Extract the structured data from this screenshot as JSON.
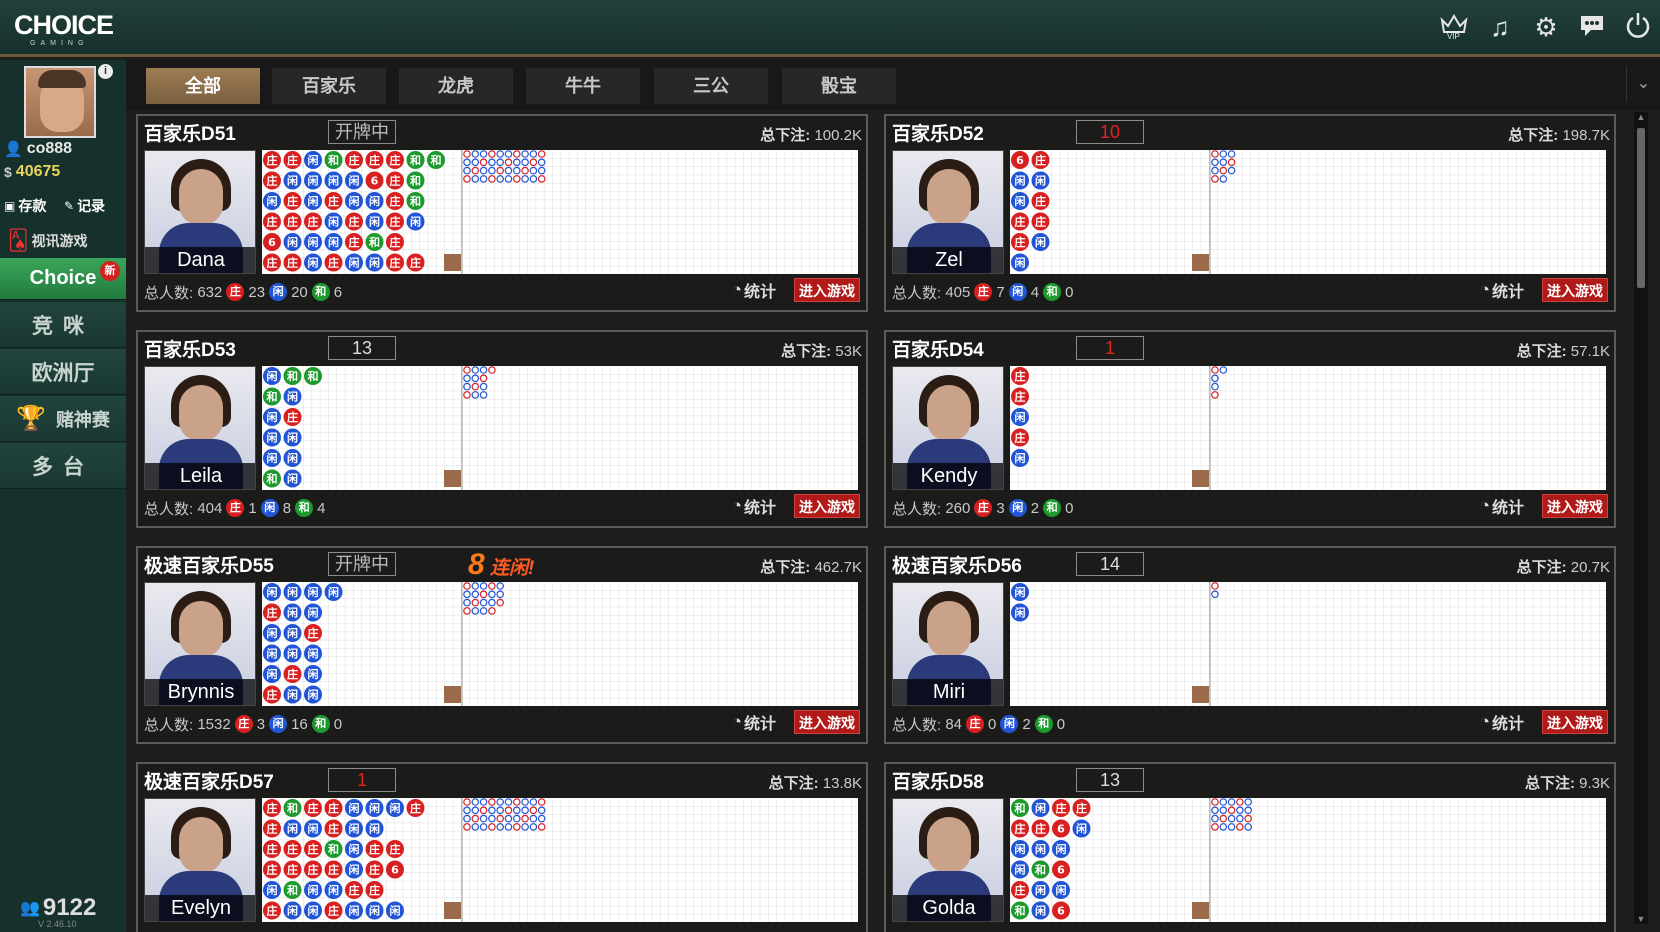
{
  "brand": {
    "logo": "CHOICE",
    "sub": "GAMING"
  },
  "user": {
    "name": "co888",
    "balance": "40675",
    "deposit": "存款",
    "records": "记录",
    "video": "视讯游戏"
  },
  "nav": [
    {
      "label": "Choice",
      "badge": "新"
    },
    {
      "label": "竞咪"
    },
    {
      "label": "欧洲厅"
    },
    {
      "label": "赌神赛"
    },
    {
      "label": "多台"
    }
  ],
  "online_count": "9122",
  "version": "V 2.46.10",
  "tabs": [
    "全部",
    "百家乐",
    "龙虎",
    "牛牛",
    "三公",
    "骰宝"
  ],
  "labels": {
    "total_bet": "总下注:",
    "players": "总人数:",
    "stats": "统计",
    "enter": "进入游戏",
    "banker": "庄",
    "player": "闲",
    "tie": "和"
  },
  "colors": {
    "banker": "#d82020",
    "player": "#2155d6",
    "tie": "#1d9a2d",
    "accent": "#8b6e49"
  },
  "tables": [
    {
      "name": "百家乐D51",
      "status": "开牌中",
      "status_type": "text",
      "streak": "",
      "total_bet": "100.2K",
      "dealer": "Dana",
      "players": "632",
      "banker": "23",
      "player": "20",
      "tie": "6"
    },
    {
      "name": "百家乐D52",
      "status": "10",
      "status_type": "red",
      "streak": "",
      "total_bet": "198.7K",
      "dealer": "Zel",
      "players": "405",
      "banker": "7",
      "player": "4",
      "tie": "0"
    },
    {
      "name": "百家乐D53",
      "status": "13",
      "status_type": "white",
      "streak": "",
      "total_bet": "53K",
      "dealer": "Leila",
      "players": "404",
      "banker": "1",
      "player": "8",
      "tie": "4"
    },
    {
      "name": "百家乐D54",
      "status": "1",
      "status_type": "red",
      "streak": "",
      "total_bet": "57.1K",
      "dealer": "Kendy",
      "players": "260",
      "banker": "3",
      "player": "2",
      "tie": "0"
    },
    {
      "name": "极速百家乐D55",
      "status": "开牌中",
      "status_type": "text",
      "streak_num": "8",
      "streak": "连闲!",
      "total_bet": "462.7K",
      "dealer": "Brynnis",
      "players": "1532",
      "banker": "3",
      "player": "16",
      "tie": "0"
    },
    {
      "name": "极速百家乐D56",
      "status": "14",
      "status_type": "white",
      "streak": "",
      "total_bet": "20.7K",
      "dealer": "Miri",
      "players": "84",
      "banker": "0",
      "player": "2",
      "tie": "0"
    },
    {
      "name": "极速百家乐D57",
      "status": "1",
      "status_type": "red",
      "streak": "",
      "total_bet": "13.8K",
      "dealer": "Evelyn",
      "players": "",
      "banker": "",
      "player": "",
      "tie": ""
    },
    {
      "name": "百家乐D58",
      "status": "13",
      "status_type": "white",
      "streak": "",
      "total_bet": "9.3K",
      "dealer": "Golda",
      "players": "",
      "banker": "",
      "player": "",
      "tie": ""
    }
  ],
  "bead_roads": [
    [
      "BBPTBBBTT",
      "BPPPP6BT",
      "PBPBPPBT",
      "BBBPBPBP",
      "6PPPBTB",
      "BBPBPPBB"
    ],
    [
      "6B",
      "PP",
      "PB",
      "BB",
      "BP",
      "P"
    ],
    [
      "PTT",
      "TP",
      "PB",
      "PP",
      "PP",
      "TP"
    ],
    [
      "B",
      "B",
      "P",
      "B",
      "P"
    ],
    [
      "PPPP",
      "BPP",
      "PPB",
      "PPP",
      "PBP",
      "BPP"
    ],
    [
      "P",
      "P"
    ],
    [
      "BTBBPPPB",
      "BPPBPP",
      "BBBTPBB",
      "BBBBPB6",
      "PTPPBB",
      "BPPBPPP"
    ],
    [
      "TPBB",
      "BB6P",
      "PPP",
      "PT6",
      "BPP",
      "TP6"
    ]
  ]
}
